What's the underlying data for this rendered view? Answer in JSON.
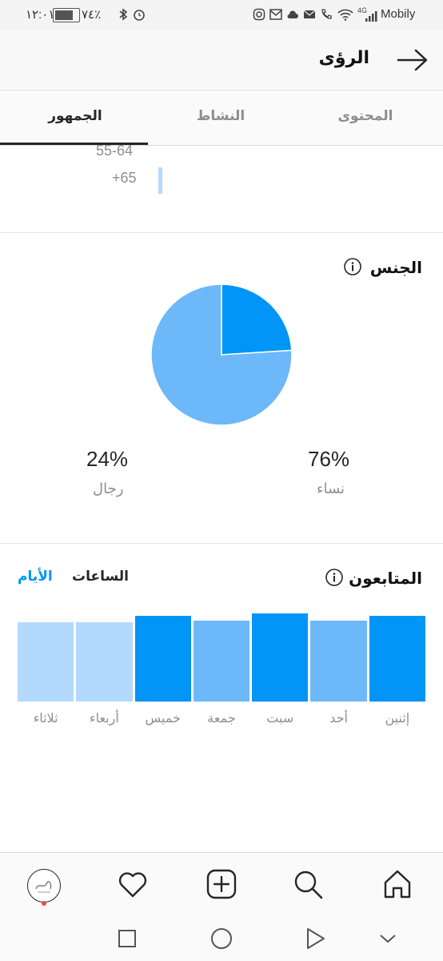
{
  "status_bar": {
    "time": "١٢:٠١",
    "battery": "٧٤٪",
    "network_type": "4G",
    "carrier": "Mobily"
  },
  "header": {
    "title": "الرؤى"
  },
  "tabs": [
    {
      "label": "المحتوى"
    },
    {
      "label": "النشاط"
    },
    {
      "label": "الجمهور"
    }
  ],
  "age_range": {
    "labels": [
      "55-64",
      "+65"
    ]
  },
  "gender": {
    "title": "الجنس",
    "men_pct": "24%",
    "men_label": "رجال",
    "women_pct": "76%",
    "women_label": "نساء",
    "colors": {
      "men": "#0095f6",
      "women": "#6cb8f9"
    }
  },
  "followers": {
    "title": "المتابعون",
    "toggle_hours": "الساعات",
    "toggle_days": "الأيام",
    "days": [
      "إثنين",
      "أحد",
      "سبت",
      "جمعة",
      "خميس",
      "أربعاء",
      "ثلاثاء"
    ],
    "levels": [
      0.67,
      0.63,
      0.69,
      0.63,
      0.67,
      0.62,
      0.62
    ],
    "colors": [
      "#0095f6",
      "#6cb8f9",
      "#0095f6",
      "#6cb8f9",
      "#0095f6",
      "#b3dafc",
      "#b3dafc"
    ]
  },
  "nav": {
    "icons": [
      "home-icon",
      "search-icon",
      "new-post-icon",
      "activity-icon",
      "profile-avatar"
    ]
  },
  "chart_data": [
    {
      "type": "pie",
      "title": "الجنس",
      "categories": [
        "رجال",
        "نساء"
      ],
      "values": [
        24,
        76
      ]
    },
    {
      "type": "bar",
      "title": "المتابعون",
      "categories": [
        "إثنين",
        "أحد",
        "سبت",
        "جمعة",
        "خميس",
        "أربعاء",
        "ثلاثاء"
      ],
      "values": [
        0.67,
        0.63,
        0.69,
        0.63,
        0.67,
        0.62,
        0.62
      ]
    }
  ]
}
